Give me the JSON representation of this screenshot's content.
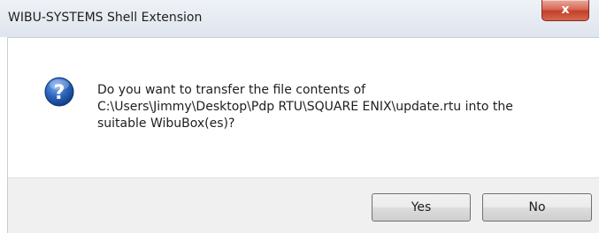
{
  "window": {
    "title": "WIBU-SYSTEMS Shell Extension",
    "close_icon": "close-icon"
  },
  "message": {
    "icon": "question-icon",
    "lines": [
      "Do you want to transfer the file contents of",
      "C:\\Users\\Jimmy\\Desktop\\Pdp RTU\\SQUARE ENIX\\update.rtu into the",
      "suitable WibuBox(es)?"
    ]
  },
  "buttons": {
    "yes_label": "Yes",
    "no_label": "No"
  },
  "colors": {
    "close_button": "#c3412b",
    "question_icon": "#2a5da8",
    "footer_background": "#f0f0f0"
  }
}
